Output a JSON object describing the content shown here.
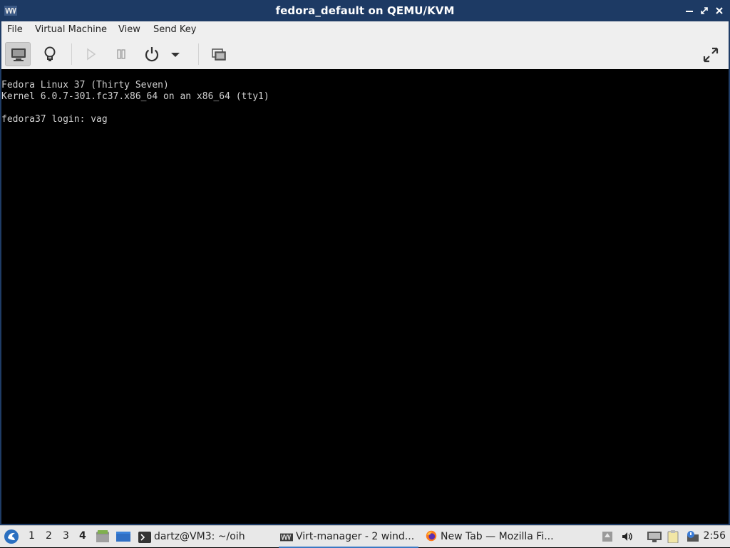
{
  "window": {
    "title": "fedora_default on QEMU/KVM",
    "controls": {
      "minimize": "−",
      "maximize": "⤢",
      "close": "✕"
    }
  },
  "menu": {
    "file": "File",
    "virtual_machine": "Virtual Machine",
    "view": "View",
    "send_key": "Send Key"
  },
  "toolbar": {
    "icons": [
      "console-icon",
      "lightbulb-icon",
      "play-icon",
      "pause-icon",
      "power-icon",
      "dropdown-arrow-icon",
      "snapshots-icon",
      "fullscreen-icon"
    ]
  },
  "console": {
    "text": "Fedora Linux 37 (Thirty Seven)\nKernel 6.0.7-301.fc37.x86_64 on an x86_64 (tty1)\n\nfedora37 login: vag"
  },
  "taskbar": {
    "workspaces": [
      "1",
      "2",
      "3",
      "4"
    ],
    "active_workspace": "4",
    "tasks": [
      {
        "label": "dartz@VM3: ~/oih",
        "icon": "terminal-icon"
      },
      {
        "label": "Virt-manager - 2 wind...",
        "icon": "virt-manager-icon"
      },
      {
        "label": "New Tab — Mozilla Fi...",
        "icon": "firefox-icon"
      }
    ],
    "clock": "2:56"
  },
  "colors": {
    "titlebar": "#1d3a64",
    "console_bg": "#000000",
    "console_fg": "#d0d0d0",
    "accent": "#3b79c2"
  }
}
